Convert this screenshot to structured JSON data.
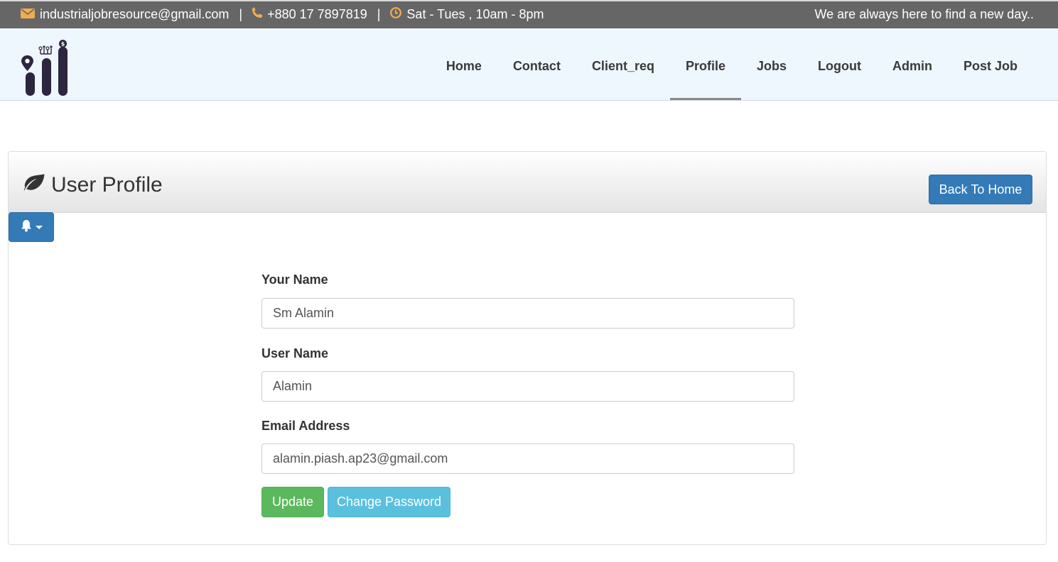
{
  "topbar": {
    "email": "industrialjobresource@gmail.com",
    "separator": "|",
    "phone": "+880 17 7897819",
    "hours": "Sat - Tues , 10am - 8pm",
    "tagline": "We are always here to find a new day..",
    "icons": [
      "envelope-icon",
      "phone-icon",
      "clock-icon"
    ],
    "icon_color": "#f0ad4e"
  },
  "nav": {
    "items": [
      {
        "label": "Home"
      },
      {
        "label": "Contact"
      },
      {
        "label": "Client_req"
      },
      {
        "label": "Profile",
        "active": true
      },
      {
        "label": "Jobs"
      },
      {
        "label": "Logout"
      },
      {
        "label": "Admin"
      },
      {
        "label": "Post Job"
      }
    ]
  },
  "panel": {
    "title": "User Profile",
    "title_icon": "leaf-icon",
    "back_button": "Back To Home",
    "bell_button_icon": "bell-icon"
  },
  "form": {
    "name_label": "Your Name",
    "name_value": "Sm Alamin",
    "username_label": "User Name",
    "username_value": "Alamin",
    "email_label": "Email Address",
    "email_value": "alamin.piash.ap23@gmail.com",
    "update_button": "Update",
    "change_password_button": "Change Password"
  },
  "colors": {
    "topbar_bg": "#666666",
    "navbar_bg": "#eef6fe",
    "primary": "#337ab7",
    "success": "#5cb85c",
    "info": "#5bc0de",
    "logo": "#2c2640"
  }
}
